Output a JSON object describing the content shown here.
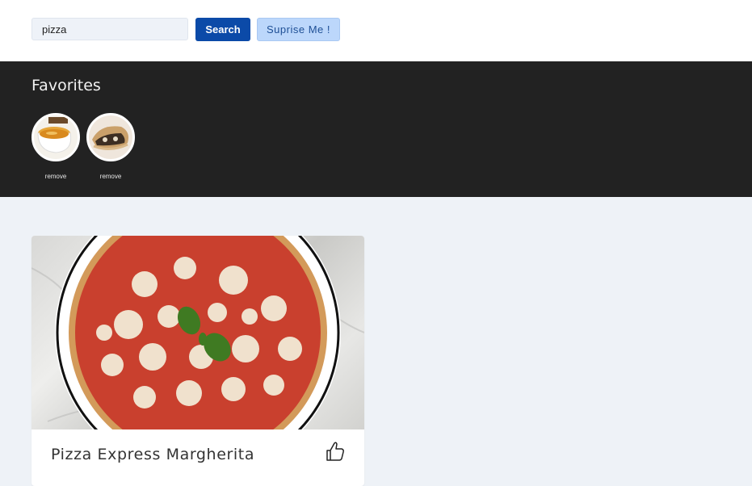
{
  "search": {
    "value": "pizza",
    "button_label": "Search",
    "surprise_label": "Suprise Me !"
  },
  "favorites": {
    "title": "Favorites",
    "items": [
      {
        "image": "soup-bowl-thumbnail",
        "remove_label": "remove"
      },
      {
        "image": "calzone-thumbnail",
        "remove_label": "remove"
      }
    ]
  },
  "meals": [
    {
      "title": "Pizza Express Margherita",
      "image": "margherita-pizza-photo",
      "like_icon": "thumbs-up-icon"
    }
  ],
  "colors": {
    "primary": "#0b4aa8",
    "secondary": "#bcd7fb",
    "favorites_bg": "#222222",
    "page_bg": "#eef2f7"
  }
}
